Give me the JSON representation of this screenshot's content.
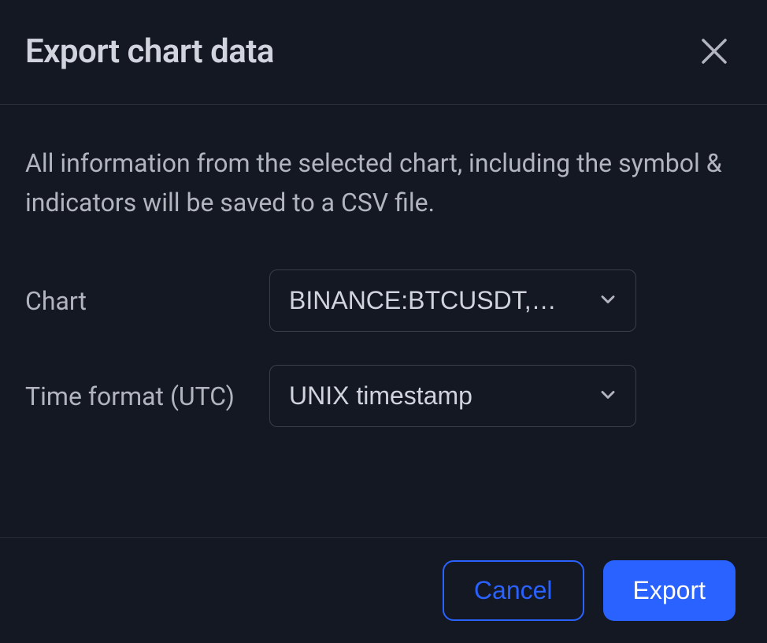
{
  "header": {
    "title": "Export chart data"
  },
  "body": {
    "description": "All information from the selected chart, including the symbol & indicators will be saved to a CSV file.",
    "fields": {
      "chart": {
        "label": "Chart",
        "value": "BINANCE:BTCUSDT,…"
      },
      "timeFormat": {
        "label": "Time format (UTC)",
        "value": "UNIX timestamp"
      }
    }
  },
  "footer": {
    "cancel_label": "Cancel",
    "export_label": "Export"
  }
}
